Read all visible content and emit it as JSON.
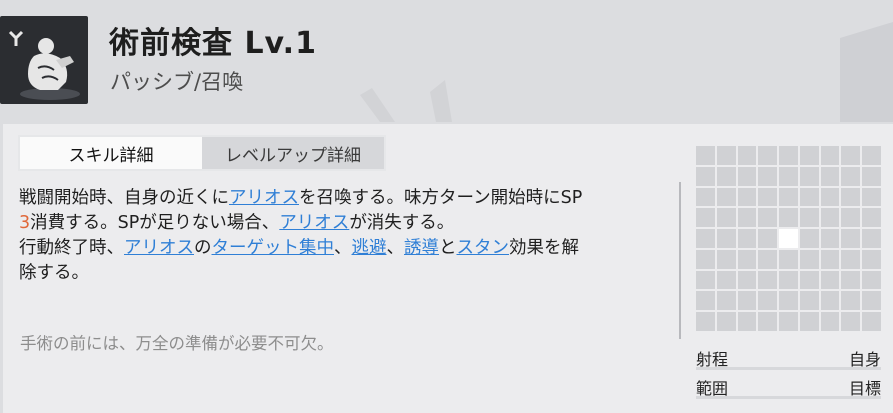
{
  "skill": {
    "title": "術前検査 Lv.1",
    "type": "パッシブ/召喚",
    "icon": "wrestler-kneeling-icon"
  },
  "tabs": [
    {
      "label": "スキル詳細",
      "active": true
    },
    {
      "label": "レベルアップ詳細",
      "active": false
    }
  ],
  "description": {
    "p1": "戦闘開始時、自身の近くに",
    "k1": "アリオス",
    "p2": "を召喚する。味方ターン開始時にSP\n",
    "n1": "3",
    "p3": "消費する。SPが足りない場合、",
    "k2": "アリオス",
    "p4": "が消失する。\n行動終了時、",
    "k3": "アリオス",
    "p5": "の",
    "k4": "ターゲット集中",
    "p6": "、",
    "k5": "逃避",
    "p7": "、",
    "k6": "誘導",
    "p8": "と",
    "k7": "スタン",
    "p9": "効果を解\n除する。"
  },
  "flavor": "手術の前には、万全の準備が必要不可欠。",
  "range_grid": {
    "size": 9,
    "highlight_row": 4,
    "highlight_col": 4
  },
  "stats": [
    {
      "key": "射程",
      "value": "自身"
    },
    {
      "key": "範囲",
      "value": "目標"
    }
  ],
  "colors": {
    "keyword": "#2f7fd6",
    "number": "#e0683a"
  }
}
